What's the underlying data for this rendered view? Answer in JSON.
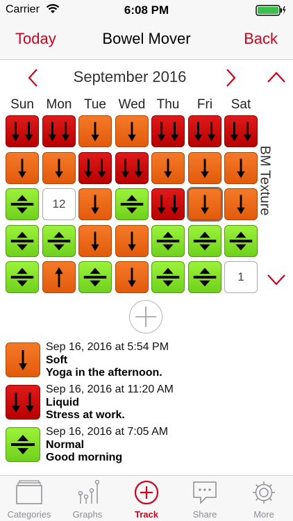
{
  "status_bar": {
    "carrier": "Carrier",
    "time": "6:08 PM"
  },
  "nav": {
    "left": "Today",
    "title": "Bowel Mover",
    "right": "Back"
  },
  "calendar": {
    "month": "September 2016",
    "weekdays": [
      "Sun",
      "Mon",
      "Tue",
      "Wed",
      "Thu",
      "Fri",
      "Sat"
    ],
    "side_label": "BM Texture",
    "rows": [
      [
        "red2",
        "red2",
        "orange",
        "orange",
        "red2",
        "red2",
        "red2"
      ],
      [
        "orange",
        "orange",
        "red2",
        "red2",
        "orange",
        "orange",
        "orange"
      ],
      [
        "green",
        "blank",
        "orange",
        "green",
        "red2",
        "orange-selected",
        "orange"
      ],
      [
        "green",
        "green",
        "orange",
        "orange",
        "green",
        "green",
        "green"
      ],
      [
        "green",
        "orange-up",
        "green",
        "orange",
        "green",
        "green",
        "blank"
      ]
    ],
    "blank_labels": {
      "2-1": "12",
      "4-6": "1"
    }
  },
  "entries": [
    {
      "kind": "orange",
      "date": "Sep 16, 2016 at 5:54 PM",
      "type": "Soft",
      "note": "Yoga in the afternoon."
    },
    {
      "kind": "red2",
      "date": "Sep 16, 2016 at 11:20 AM",
      "type": "Liquid",
      "note": "Stress at work."
    },
    {
      "kind": "green",
      "date": "Sep 16, 2016 at 7:05 AM",
      "type": "Normal",
      "note": "Good morning"
    }
  ],
  "tabs": [
    {
      "label": "Categories",
      "icon": "categories-icon"
    },
    {
      "label": "Graphs",
      "icon": "graphs-icon"
    },
    {
      "label": "Track",
      "icon": "plus-circle-icon",
      "active": true
    },
    {
      "label": "Share",
      "icon": "chat-bubble-icon"
    },
    {
      "label": "More",
      "icon": "gear-icon"
    }
  ],
  "colors": {
    "accent": "#d0021b",
    "red": "#c80a0a",
    "orange": "#ee6a1a",
    "green": "#82e02a"
  }
}
